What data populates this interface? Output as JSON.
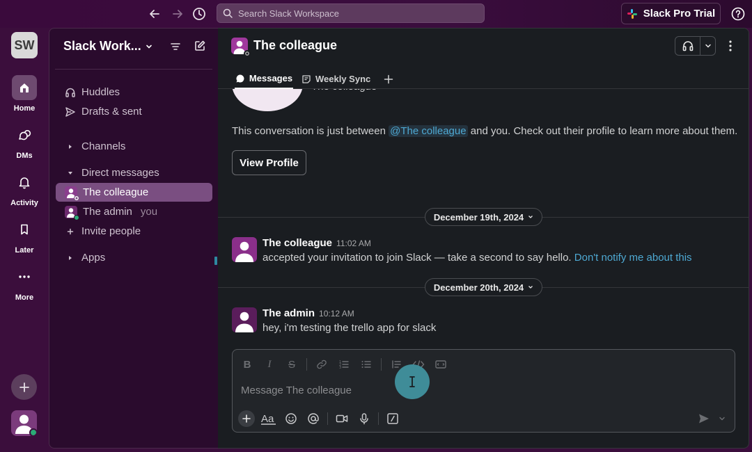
{
  "topbar": {
    "search_placeholder": "Search Slack Workspace",
    "trial_label": "Slack Pro Trial"
  },
  "rail": {
    "workspace_initials": "SW",
    "items": [
      {
        "label": "Home",
        "icon": "home-icon"
      },
      {
        "label": "DMs",
        "icon": "dms-icon"
      },
      {
        "label": "Activity",
        "icon": "bell-icon"
      },
      {
        "label": "Later",
        "icon": "bookmark-icon"
      },
      {
        "label": "More",
        "icon": "more-icon"
      }
    ]
  },
  "sidebar": {
    "workspace_name": "Slack Work...",
    "nav": [
      {
        "label": "Huddles",
        "icon": "headphones-icon"
      },
      {
        "label": "Drafts & sent",
        "icon": "send-icon"
      }
    ],
    "channels_label": "Channels",
    "dm_label": "Direct messages",
    "dms": [
      {
        "label": "The colleague",
        "suffix": ""
      },
      {
        "label": "The admin",
        "suffix": "you"
      }
    ],
    "invite_label": "Invite people",
    "apps_label": "Apps"
  },
  "channel": {
    "name": "The colleague",
    "tabs": [
      {
        "label": "Messages"
      },
      {
        "label": "Weekly Sync"
      }
    ],
    "intro_name_partial": "The colleague",
    "intro_before": "This conversation is just between ",
    "intro_mention": "@The colleague",
    "intro_after": " and you. Check out their profile to learn more about them.",
    "view_profile_label": "View Profile",
    "dates": [
      "December 19th, 2024",
      "December 20th, 2024"
    ],
    "messages": [
      {
        "author": "The colleague",
        "time": "11:02 AM",
        "text": "accepted your invitation to join Slack — take a second to say hello.",
        "link": "Don't notify me about this"
      },
      {
        "author": "The admin",
        "time": "10:12 AM",
        "text": "hey, i'm testing the trello app for slack",
        "link": ""
      }
    ],
    "composer_placeholder": "Message The colleague"
  },
  "colors": {
    "aubergine": "#3b0e3c",
    "sidebar_active": "#7a4e81",
    "link": "#4ea9d3",
    "online": "#2bac76",
    "cursor": "#3f8c98"
  }
}
